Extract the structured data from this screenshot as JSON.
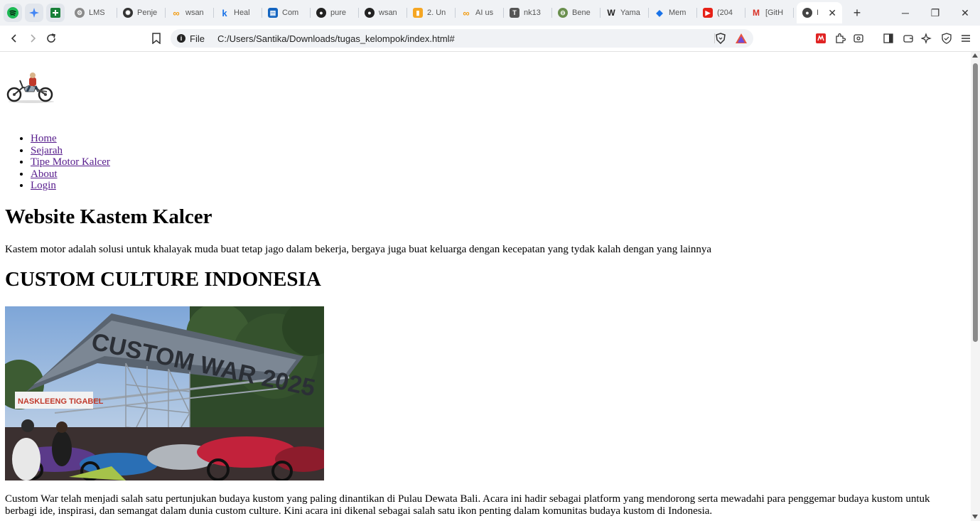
{
  "browser": {
    "tabs": [
      {
        "title": "LMS",
        "icon": "lms-icon",
        "color": "#8a8a8a"
      },
      {
        "title": "Penje",
        "icon": "openai-icon",
        "color": "#333333"
      },
      {
        "title": "wsan",
        "icon": "infinity-icon",
        "color": "#f39c12"
      },
      {
        "title": "Heal",
        "icon": "k-icon",
        "color": "#1a73e8"
      },
      {
        "title": "Com",
        "icon": "book-icon",
        "color": "#1565c0"
      },
      {
        "title": "pure",
        "icon": "github-icon",
        "color": "#222222"
      },
      {
        "title": "wsan",
        "icon": "github-icon",
        "color": "#222222"
      },
      {
        "title": "2. Un",
        "icon": "chart-icon",
        "color": "#f5a623"
      },
      {
        "title": "AI us",
        "icon": "infinity-icon",
        "color": "#f39c12"
      },
      {
        "title": "nk13",
        "icon": "shirt-icon",
        "color": "#555555"
      },
      {
        "title": "Bene",
        "icon": "globe-icon",
        "color": "#6a8f4e"
      },
      {
        "title": "Yama",
        "icon": "wikipedia-icon",
        "color": "#222222"
      },
      {
        "title": "Mem",
        "icon": "code-icon",
        "color": "#1a73e8"
      },
      {
        "title": "(204",
        "icon": "youtube-icon",
        "color": "#e62117"
      },
      {
        "title": "[GitH",
        "icon": "gmail-icon",
        "color": "#d93025"
      }
    ],
    "active_tab": {
      "title": "I",
      "close": "✕"
    },
    "new_tab": "+",
    "controls": {
      "minimize": "─",
      "restore": "❐",
      "close": "✕"
    },
    "address": {
      "scheme": "File",
      "url": "C:/Users/Santika/Downloads/tugas_kelompok/index.html#"
    }
  },
  "page": {
    "nav": [
      "Home",
      "Sejarah",
      "Tipe Motor Kalcer",
      "About",
      "Login"
    ],
    "title": "Website Kastem Kalcer",
    "intro": "Kastem motor adalah solusi untuk khalayak muda buat tetap jago dalam bekerja, bergaya juga buat keluarga dengan kecepatan yang tydak kalah dengan yang lainnya",
    "heading2": "CUSTOM CULTURE INDONESIA",
    "photo_texts": {
      "banner": "CUSTOM WAR 2025",
      "sign": "NASKLEENG TIGABEL"
    },
    "body": "Custom War telah menjadi salah satu pertunjukan budaya kustom yang paling dinantikan di Pulau Dewata Bali. Acara ini hadir sebagai platform yang mendorong serta mewadahi para penggemar budaya kustom untuk berbagi ide, inspirasi, dan semangat dalam dunia custom culture. Kini acara ini dikenal sebagai salah satu ikon penting dalam komunitas budaya kustom di Indonesia."
  },
  "colors": {
    "link": "#551a8b",
    "tabstrip": "#f0f2f5"
  }
}
